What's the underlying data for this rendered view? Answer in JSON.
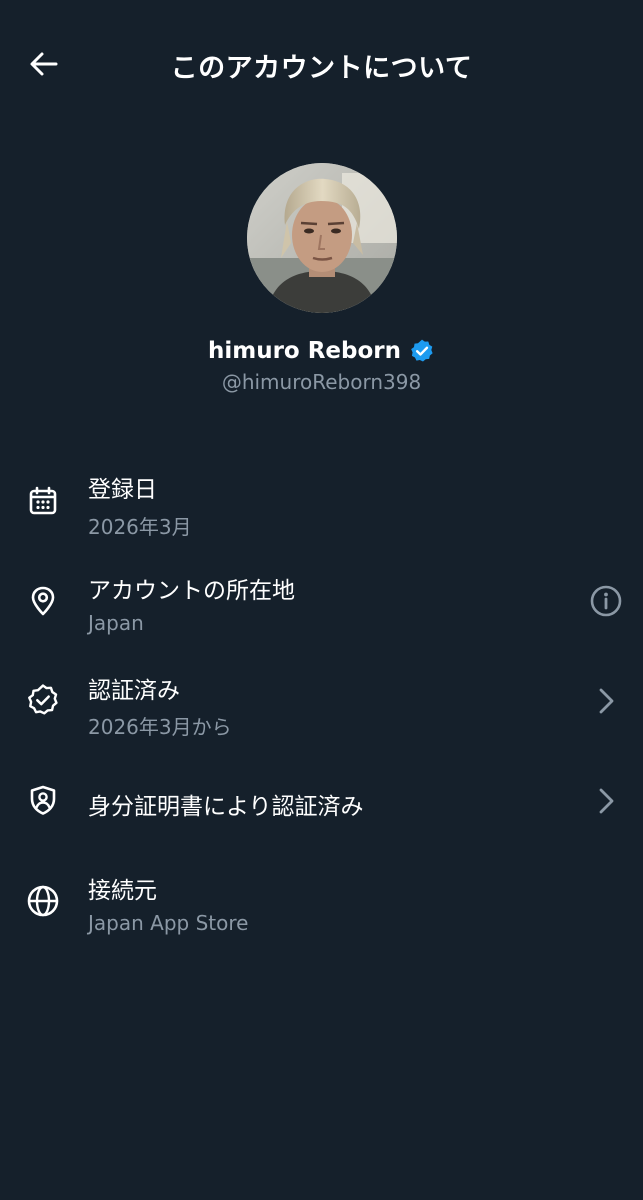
{
  "header": {
    "title": "このアカウントについて",
    "back_icon": "arrow-left-icon"
  },
  "profile": {
    "display_name": "himuro Reborn",
    "handle": "@himuroReborn398",
    "verified": true,
    "badge_color": "#1d9bf0"
  },
  "rows": [
    {
      "icon": "calendar-icon",
      "label": "登録日",
      "value": "2026年3月"
    },
    {
      "icon": "location-pin-icon",
      "label": "アカウントの所在地",
      "value": "Japan",
      "trailing_icon": "info-icon"
    },
    {
      "icon": "verified-badge-outline-icon",
      "label": "認証済み",
      "value": "2026年3月から",
      "trailing_icon": "chevron-right-icon"
    },
    {
      "icon": "id-shield-icon",
      "label": "身分証明書により認証済み",
      "trailing_icon": "chevron-right-icon"
    },
    {
      "icon": "globe-icon",
      "label": "接続元",
      "value": "Japan App Store"
    }
  ],
  "colors": {
    "background": "#15202b",
    "primary_text": "#ffffff",
    "secondary_text": "#8b98a5",
    "accent": "#1d9bf0"
  }
}
